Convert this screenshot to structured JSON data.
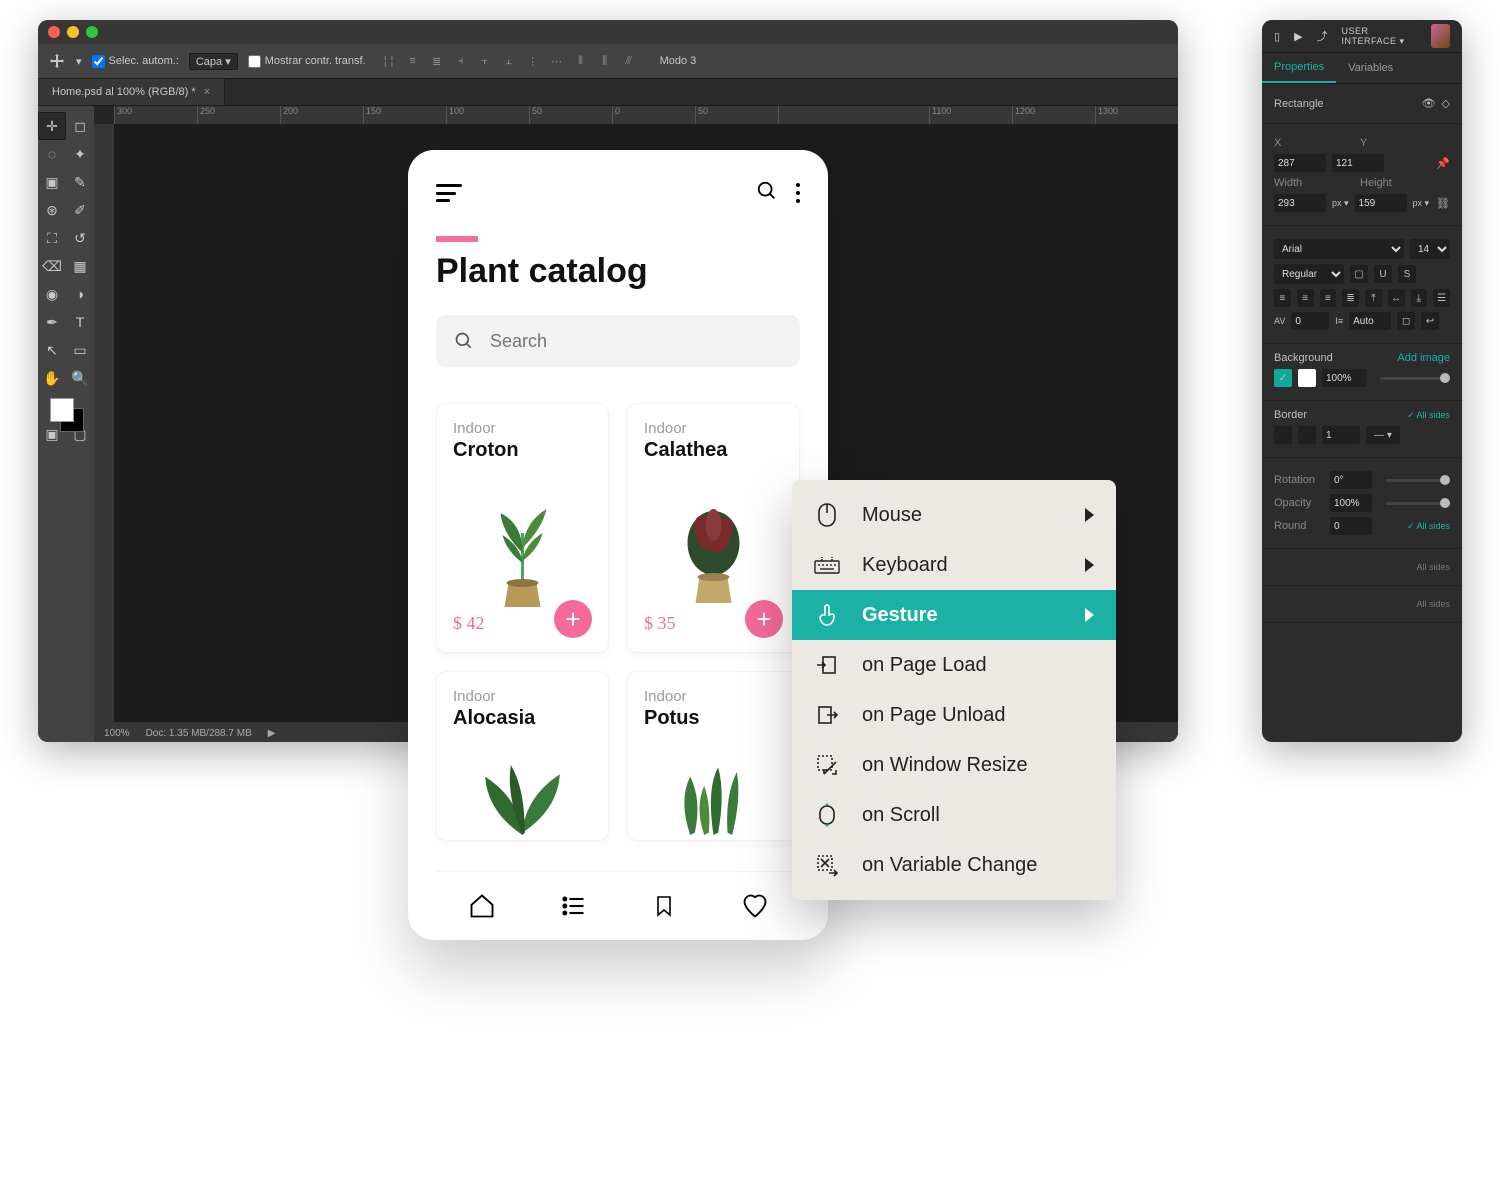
{
  "photoshop": {
    "options": {
      "autoselect": "Selec. autom.:",
      "autoselect_target": "Capa",
      "show_transform": "Mostrar contr. transf.",
      "mode_label": "Modo 3"
    },
    "tab": "Home.psd al 100% (RGB/8) *",
    "ruler": [
      "300",
      "250",
      "200",
      "150",
      "100",
      "50",
      "0",
      "50",
      "…",
      "1100",
      "1200",
      "1300"
    ],
    "status": {
      "zoom": "100%",
      "doc": "Doc: 1.35 MB/288.7 MB"
    }
  },
  "inspector": {
    "userlabel": "USER INTERFACE ▾",
    "tabs": {
      "properties": "Properties",
      "variables": "Variables"
    },
    "element": "Rectangle",
    "x": {
      "label": "X",
      "value": "287"
    },
    "y": {
      "label": "Y",
      "value": "121"
    },
    "w": {
      "label": "Width",
      "value": "293",
      "unit": "px ▾"
    },
    "h": {
      "label": "Height",
      "value": "159",
      "unit": "px ▾"
    },
    "font": {
      "family": "Arial",
      "size": "14",
      "weight": "Regular"
    },
    "letterspace": "0",
    "lineheight": "Auto",
    "bg": {
      "label": "Background",
      "add": "Add image",
      "value": "100%"
    },
    "border": {
      "label": "Border",
      "all": "All sides",
      "value": "1"
    },
    "rotation": {
      "label": "Rotation",
      "value": "0°"
    },
    "opacity": {
      "label": "Opacity",
      "value": "100%"
    },
    "round": {
      "label": "Round",
      "value": "0",
      "all": "All sides"
    },
    "allsides": "All sides"
  },
  "phone": {
    "title": "Plant catalog",
    "search_placeholder": "Search",
    "cards": [
      {
        "cat": "Indoor",
        "name": "Croton",
        "price": "$ 42"
      },
      {
        "cat": "Indoor",
        "name": "Calathea",
        "price": "$ 35"
      },
      {
        "cat": "Indoor",
        "name": "Alocasia",
        "price": ""
      },
      {
        "cat": "Indoor",
        "name": "Potus",
        "price": ""
      }
    ]
  },
  "ctx": {
    "items": [
      {
        "label": "Mouse",
        "arrow": true
      },
      {
        "label": "Keyboard",
        "arrow": true
      },
      {
        "label": "Gesture",
        "arrow": true,
        "active": true
      },
      {
        "label": "on Page Load"
      },
      {
        "label": "on Page Unload"
      },
      {
        "label": "on Window Resize"
      },
      {
        "label": "on Scroll"
      },
      {
        "label": "on Variable Change"
      }
    ]
  }
}
